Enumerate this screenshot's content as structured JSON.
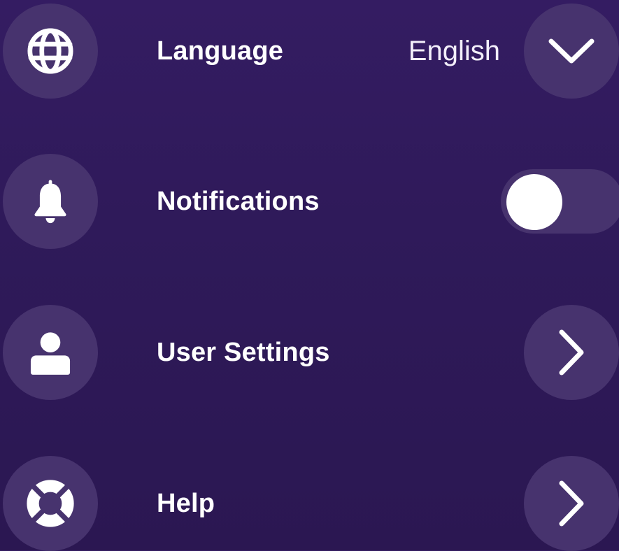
{
  "settings": {
    "items": [
      {
        "label": "Language",
        "icon": "globe-icon",
        "value": "English",
        "control": "dropdown",
        "control_icon": "chevron-down-icon"
      },
      {
        "label": "Notifications",
        "icon": "bell-icon",
        "control": "toggle",
        "enabled": false
      },
      {
        "label": "User Settings",
        "icon": "user-icon",
        "control": "navigate",
        "control_icon": "chevron-right-icon"
      },
      {
        "label": "Help",
        "icon": "lifebuoy-icon",
        "control": "navigate",
        "control_icon": "chevron-right-icon"
      }
    ]
  },
  "colors": {
    "background": "#2f1a5a",
    "circle": "#47336e",
    "text": "#ffffff"
  }
}
